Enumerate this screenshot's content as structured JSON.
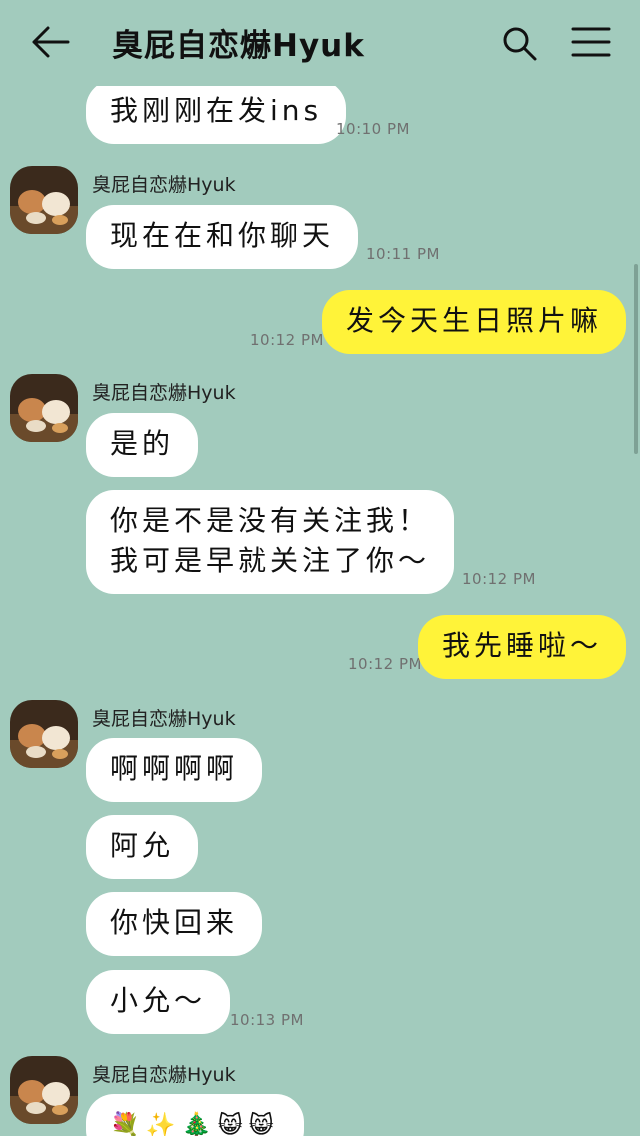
{
  "header": {
    "title": "臭屁自恋爀Hyuk"
  },
  "messages": [
    {
      "text": "我刚刚在发ins",
      "time": "10:10 PM"
    },
    {
      "sender": "臭屁自恋爀Hyuk",
      "text": "现在在和你聊天",
      "time": "10:11 PM"
    },
    {
      "text": "发今天生日照片嘛",
      "time": "10:12 PM"
    },
    {
      "sender": "臭屁自恋爀Hyuk",
      "text": "是的"
    },
    {
      "line1": "你是不是没有关注我！",
      "line2": "我可是早就关注了你～",
      "time": "10:12 PM"
    },
    {
      "text": "我先睡啦～",
      "time": "10:12 PM"
    },
    {
      "sender": "臭屁自恋爀Hyuk",
      "text": "啊啊啊啊"
    },
    {
      "text": "阿允"
    },
    {
      "text": "你快回来"
    },
    {
      "text": "小允～",
      "time": "10:13 PM"
    },
    {
      "sender": "臭屁自恋爀Hyuk",
      "text": "💐✨🎄😸😸"
    }
  ]
}
